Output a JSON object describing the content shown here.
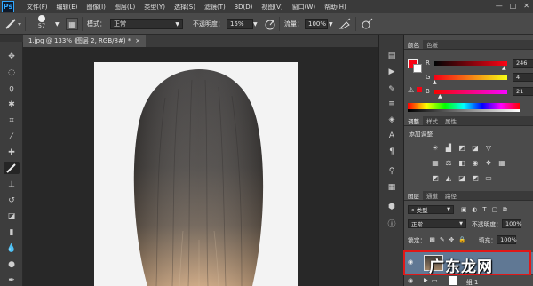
{
  "app": {
    "logo": "Ps"
  },
  "menu": [
    "文件(F)",
    "编辑(E)",
    "图像(I)",
    "图层(L)",
    "类型(Y)",
    "选择(S)",
    "滤镜(T)",
    "3D(D)",
    "视图(V)",
    "窗口(W)",
    "帮助(H)"
  ],
  "window_controls": [
    "minimize-icon",
    "maximize-icon",
    "close-icon"
  ],
  "options": {
    "brush_size": "57",
    "mode_label": "模式：",
    "mode_value": "正常",
    "opacity_label": "不透明度：",
    "opacity_value": "15%",
    "flow_label": "流量：",
    "flow_value": "100%"
  },
  "document": {
    "tab_title": "1.jpg @ 133% (图层 2, RGB/8#) *",
    "close": "×"
  },
  "color_panel": {
    "tabs": [
      "颜色",
      "色板"
    ],
    "foreground": "#f60415",
    "background": "#ffffff",
    "r_label": "R",
    "r_value": "246",
    "g_label": "G",
    "g_value": "4",
    "b_label": "B",
    "b_value": "21"
  },
  "adjust_panel": {
    "tabs": [
      "调整",
      "样式",
      "属性"
    ],
    "add_label": "添加调整"
  },
  "layers_panel": {
    "tabs": [
      "图层",
      "通道",
      "路径"
    ],
    "kind_label": "类型",
    "blend_mode": "正常",
    "opacity_label": "不透明度：",
    "opacity_value": "100%",
    "lock_label": "锁定：",
    "fill_label": "填充：",
    "fill_value": "100%",
    "group_label": "组 1"
  },
  "watermark": "广东龙网"
}
